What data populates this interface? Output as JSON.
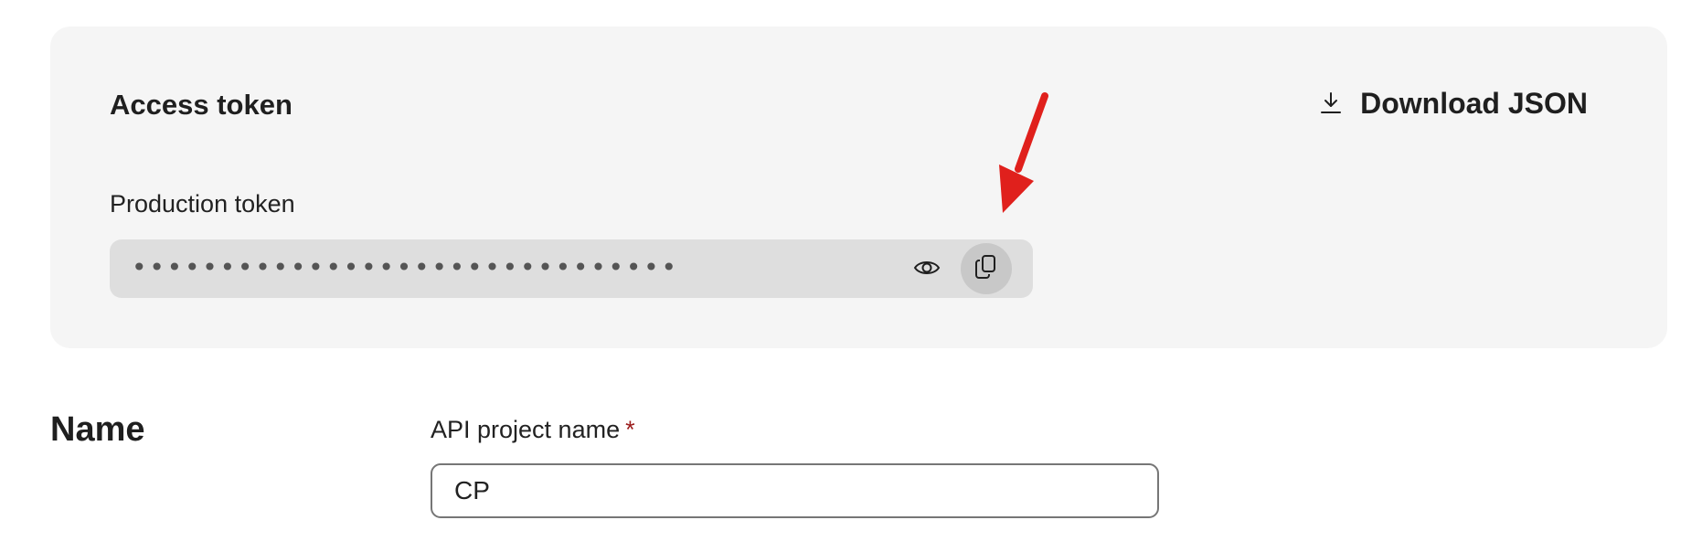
{
  "access_token_card": {
    "title": "Access token",
    "download_label": "Download JSON",
    "download_icon": "download-icon",
    "token_label": "Production token",
    "token_value": "•••••••••••••••••••••••••••••••",
    "show_icon": "eye-icon",
    "copy_icon": "copy-icon"
  },
  "annotation": {
    "arrow_color": "#e0201c"
  },
  "name_section": {
    "heading": "Name",
    "field_label": "API project name",
    "required_mark": "*",
    "field_value": "CP"
  },
  "colors": {
    "card_background": "#f5f5f5",
    "token_field_background": "#dedede",
    "copy_button_background": "#c8c8c8",
    "required_color": "#9b1c1c"
  }
}
